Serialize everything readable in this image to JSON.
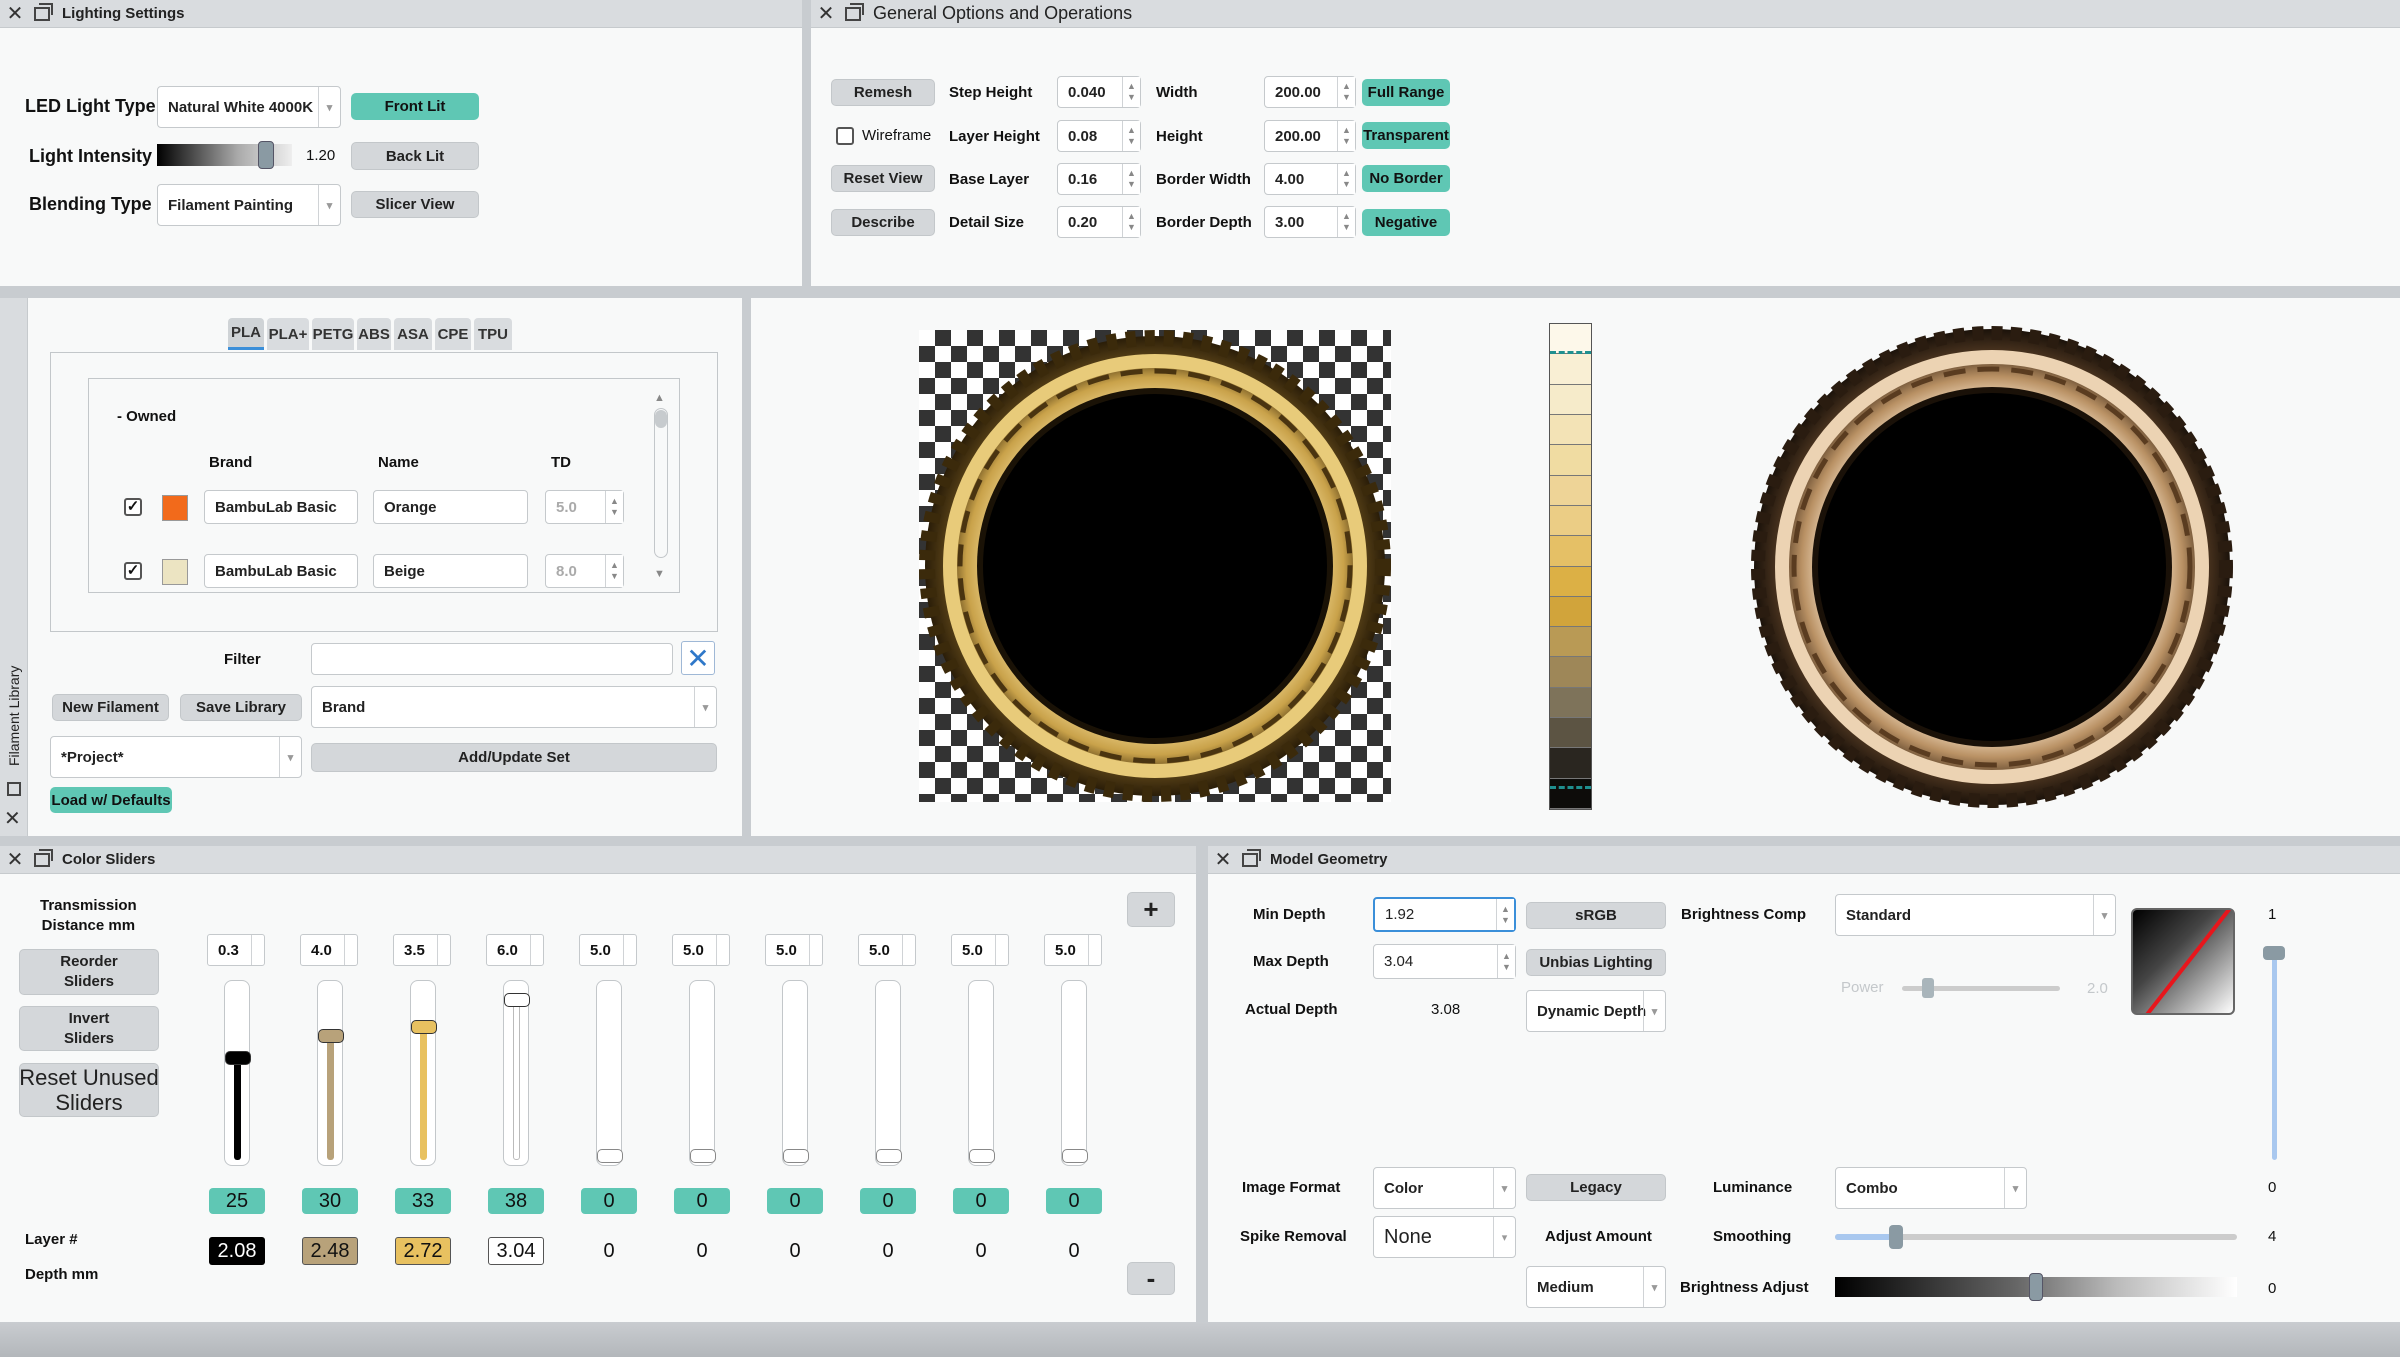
{
  "lighting": {
    "title": "Lighting Settings",
    "led_label": "LED Light Type",
    "led_value": "Natural White 4000K",
    "intensity_label": "Light Intensity",
    "intensity_value": "1.20",
    "intensity_fraction": 0.85,
    "blending_label": "Blending Type",
    "blending_value": "Filament Painting",
    "front_lit": "Front Lit",
    "back_lit": "Back Lit",
    "slicer_view": "Slicer View"
  },
  "general": {
    "title": "General Options and Operations",
    "remesh": "Remesh",
    "wireframe": "Wireframe",
    "reset_view": "Reset View",
    "describe": "Describe",
    "step_height_label": "Step Height",
    "step_height": "0.040",
    "layer_height_label": "Layer Height",
    "layer_height": "0.08",
    "base_layer_label": "Base Layer",
    "base_layer": "0.16",
    "detail_size_label": "Detail Size",
    "detail_size": "0.20",
    "width_label": "Width",
    "width": "200.00",
    "height_label": "Height",
    "height": "200.00",
    "border_width_label": "Border Width",
    "border_width": "4.00",
    "border_depth_label": "Border Depth",
    "border_depth": "3.00",
    "full_range": "Full Range",
    "transparent": "Transparent",
    "no_border": "No Border",
    "negative": "Negative"
  },
  "library": {
    "side_title": "Filament Library",
    "tabs": [
      "PLA",
      "PLA+",
      "PETG",
      "ABS",
      "ASA",
      "CPE",
      "TPU"
    ],
    "group": "- Owned",
    "col_brand": "Brand",
    "col_name": "Name",
    "col_td": "TD",
    "rows": [
      {
        "brand": "BambuLab Basic",
        "name": "Orange",
        "td": "5.0",
        "color": "#f26a1b"
      },
      {
        "brand": "BambuLab Basic",
        "name": "Beige",
        "td": "8.0",
        "color": "#ece4c2"
      }
    ],
    "filter_label": "Filter",
    "filter_value": "",
    "new_filament": "New Filament",
    "save_library": "Save Library",
    "sort_value": "Brand",
    "project_value": "*Project*",
    "add_update": "Add/Update Set",
    "load_defaults": "Load w/ Defaults"
  },
  "strip_colors": [
    "#fdf8ea",
    "#f9efd4",
    "#f6ebca",
    "#f3e3b6",
    "#f0dca2",
    "#eed497",
    "#ebcd85",
    "#e5c066",
    "#dcb045",
    "#d1a43b",
    "#b99a55",
    "#9e8758",
    "#7e735a",
    "#5c5443",
    "#2a2620",
    "#0d0c0a"
  ],
  "sliders": {
    "title": "Color Sliders",
    "transmission_label": "Transmission\nDistance mm",
    "reorder": "Reorder\nSliders",
    "invert": "Invert\nSliders",
    "reset_unused": "Reset Unused\nSliders",
    "layer_label": "Layer #",
    "depth_label": "Depth mm",
    "plus": "+",
    "minus": "-",
    "channels": [
      {
        "td": "0.3",
        "layer": "25",
        "depth": "2.08",
        "color": "#000000",
        "handle_fraction": 0.37
      },
      {
        "td": "4.0",
        "layer": "30",
        "depth": "2.48",
        "color": "#b8a27a",
        "handle_fraction": 0.23
      },
      {
        "td": "3.5",
        "layer": "33",
        "depth": "2.72",
        "color": "#e8c160",
        "handle_fraction": 0.17
      },
      {
        "td": "6.0",
        "layer": "38",
        "depth": "3.04",
        "color": "#ffffff",
        "handle_fraction": 0.0
      },
      {
        "td": "5.0",
        "layer": "0",
        "depth": "0",
        "color": "#000000",
        "handle_fraction": 1.0
      },
      {
        "td": "5.0",
        "layer": "0",
        "depth": "0",
        "color": "#000000",
        "handle_fraction": 1.0
      },
      {
        "td": "5.0",
        "layer": "0",
        "depth": "0",
        "color": "#000000",
        "handle_fraction": 1.0
      },
      {
        "td": "5.0",
        "layer": "0",
        "depth": "0",
        "color": "#000000",
        "handle_fraction": 1.0
      },
      {
        "td": "5.0",
        "layer": "0",
        "depth": "0",
        "color": "#000000",
        "handle_fraction": 1.0
      },
      {
        "td": "5.0",
        "layer": "0",
        "depth": "0",
        "color": "#000000",
        "handle_fraction": 1.0
      }
    ]
  },
  "geometry": {
    "title": "Model Geometry",
    "min_depth_label": "Min Depth",
    "min_depth": "1.92",
    "max_depth_label": "Max Depth",
    "max_depth": "3.04",
    "actual_depth_label": "Actual Depth",
    "actual_depth": "3.08",
    "srgb": "sRGB",
    "unbias": "Unbias Lighting",
    "dynamic_depth": "Dynamic Depth",
    "brightness_comp_label": "Brightness Comp",
    "brightness_comp": "Standard",
    "power_label": "Power",
    "power_value": "2.0",
    "side_top": "1",
    "side_mid": "0",
    "side_smooth": "4",
    "side_bright": "0",
    "image_format_label": "Image Format",
    "image_format": "Color",
    "legacy": "Legacy",
    "luminance_label": "Luminance",
    "luminance": "Combo",
    "spike_label": "Spike Removal",
    "spike": "None",
    "adjust_amount_label": "Adjust Amount",
    "adjust_amount": "Medium",
    "smoothing_label": "Smoothing",
    "smoothing_fraction": 0.14,
    "brightness_adjust_label": "Brightness Adjust",
    "brightness_adjust_fraction": 0.5
  }
}
